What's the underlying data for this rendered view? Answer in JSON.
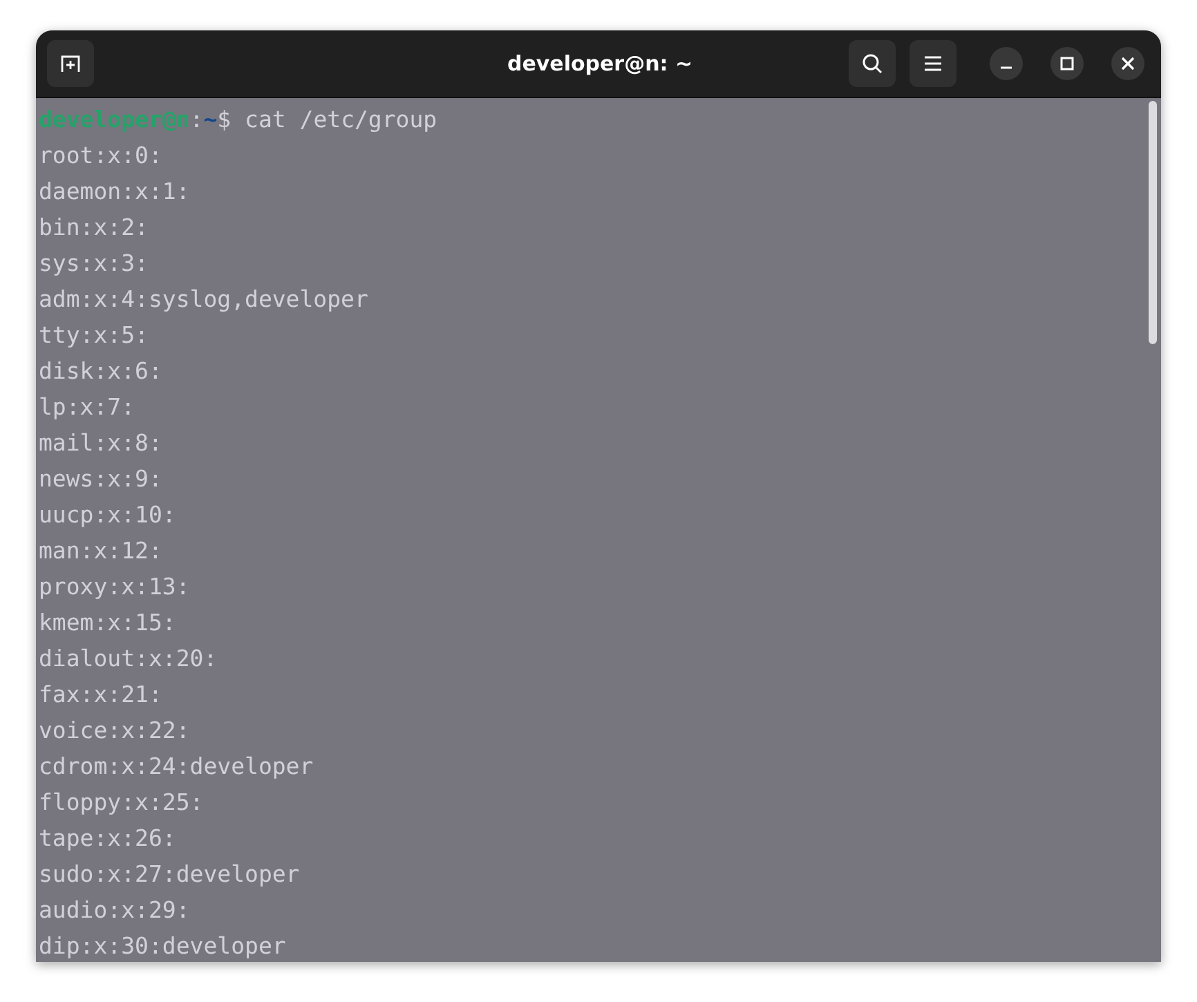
{
  "window": {
    "title": "developer@n: ~"
  },
  "prompt": {
    "user": "developer@n",
    "separator": ":",
    "path": "~",
    "symbol": "$",
    "command": "cat /etc/group"
  },
  "lines": [
    "root:x:0:",
    "daemon:x:1:",
    "bin:x:2:",
    "sys:x:3:",
    "adm:x:4:syslog,developer",
    "tty:x:5:",
    "disk:x:6:",
    "lp:x:7:",
    "mail:x:8:",
    "news:x:9:",
    "uucp:x:10:",
    "man:x:12:",
    "proxy:x:13:",
    "kmem:x:15:",
    "dialout:x:20:",
    "fax:x:21:",
    "voice:x:22:",
    "cdrom:x:24:developer",
    "floppy:x:25:",
    "tape:x:26:",
    "sudo:x:27:developer",
    "audio:x:29:",
    "dip:x:30:developer"
  ]
}
